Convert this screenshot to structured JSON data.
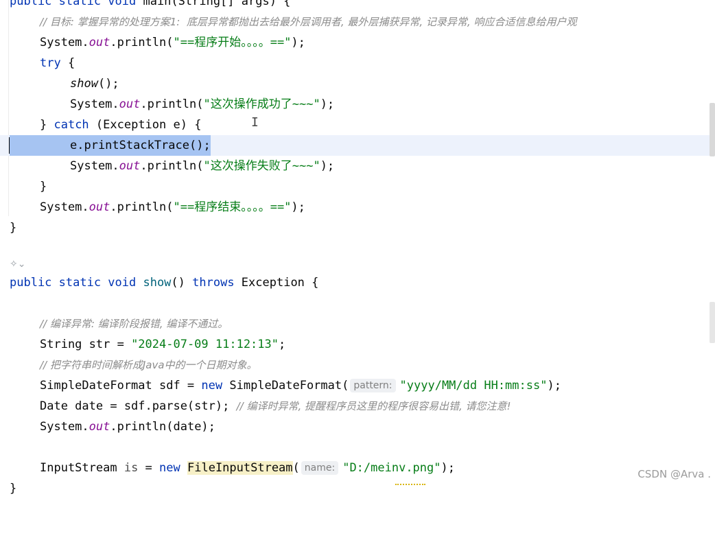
{
  "editor": {
    "lines": {
      "main_sig": {
        "kw1": "public static void",
        "name": " main(String[] args) {"
      },
      "comment_goal": "// 目标: 掌握异常的处理方案1:  底层异常都抛出去给最外层调用者, 最外层捕获异常, 记录异常, 响应合适信息给用户观",
      "print_start": {
        "a": "System.",
        "field": "out",
        "b": ".println(",
        "str": "\"==程序开始。。。。==\"",
        "c": ");"
      },
      "try_line": {
        "kw": "try",
        "rest": " {"
      },
      "show_call": {
        "name": "show",
        "rest": "();"
      },
      "print_success": {
        "a": "System.",
        "field": "out",
        "b": ".println(",
        "str": "\"这次操作成功了~~~\"",
        "c": ");"
      },
      "catch_line": {
        "a": "} ",
        "kw": "catch",
        "rest": " (Exception e) {"
      },
      "stack_trace": "e.printStackTrace();",
      "print_fail": {
        "a": "System.",
        "field": "out",
        "b": ".println(",
        "str": "\"这次操作失败了~~~\"",
        "c": ");"
      },
      "close_brace_inner": "}",
      "print_end": {
        "a": "System.",
        "field": "out",
        "b": ".println(",
        "str": "\"==程序结束。。。。==\"",
        "c": ");"
      },
      "close_brace_outer": "}",
      "show_sig": {
        "kw": "public static void",
        "name": " show",
        "b": "() ",
        "throws": "throws",
        "rest": " Exception {"
      },
      "comment_compile": "// 编译异常: 编译阶段报错, 编译不通过。",
      "str_decl": {
        "a": "String str = ",
        "str": "\"2024-07-09 11:12:13\"",
        "c": ";"
      },
      "comment_parse": "// 把字符串时间解析成Java中的一个日期对象。",
      "sdf_decl": {
        "a": "SimpleDateFormat sdf = ",
        "kw": "new",
        "b": " SimpleDateFormat(",
        "hint": "pattern:",
        "str": "\"yyyy/MM/dd HH:mm:ss\"",
        "c": ");"
      },
      "date_decl": {
        "a": "Date date = sdf.parse(str); ",
        "comment": "// 编译时异常, 提醒程序员这里的程序很容易出错, 请您注意!"
      },
      "print_date": {
        "a": "System.",
        "field": "out",
        "b": ".println(date);"
      },
      "stream_decl": {
        "a": "InputStream ",
        "var": "is",
        "b": " = ",
        "kw": "new",
        "cls": "FileInputStream",
        "c": "(",
        "hint": "name:",
        "str": "\"D:/meinv.png\"",
        "d": ");"
      },
      "final_brace": "}"
    },
    "gutter_icon": "ai-assist-icon",
    "gutter_chevron": "⌄"
  },
  "watermark": "CSDN @Arva ."
}
